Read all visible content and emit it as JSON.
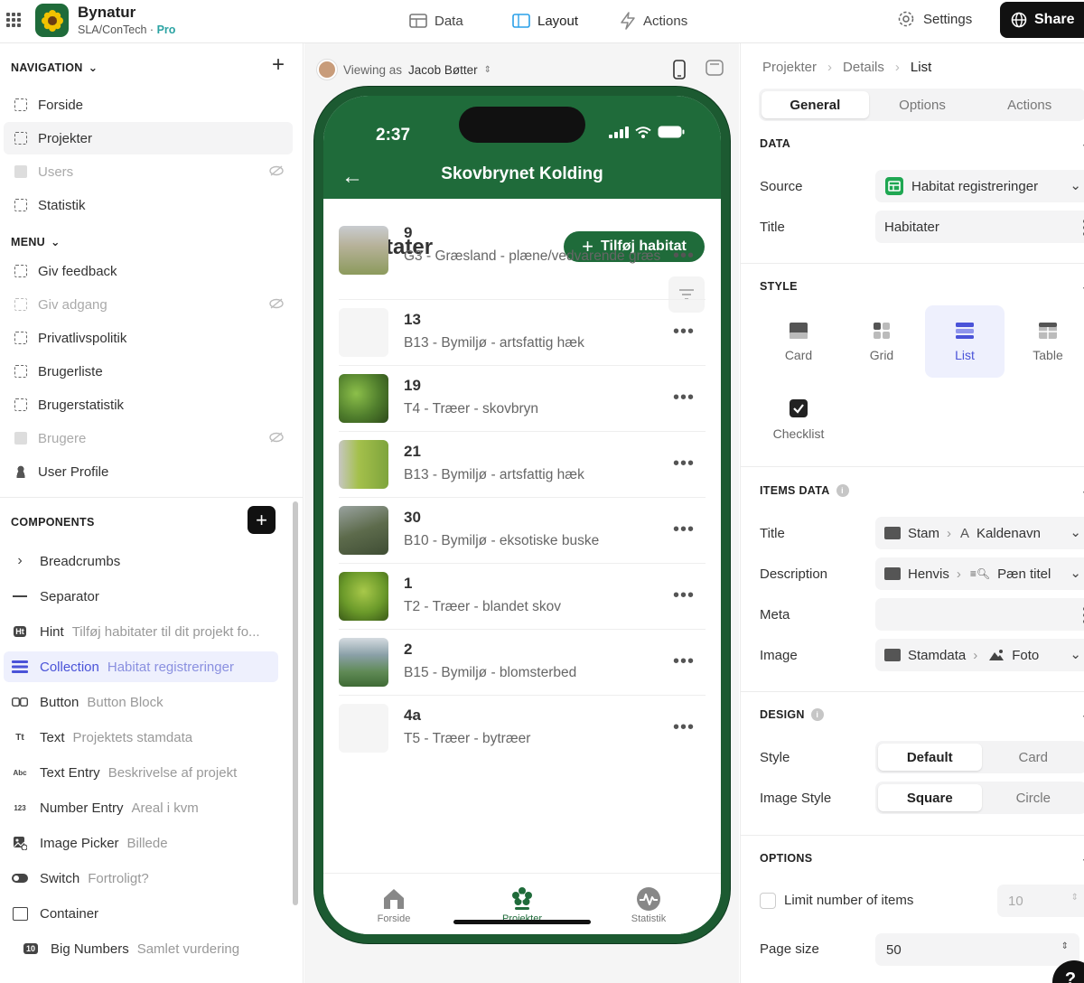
{
  "app": {
    "name": "Bynatur",
    "org": "SLA/ConTech",
    "dot": "·",
    "plan": "Pro"
  },
  "top_tabs": [
    {
      "label": "Data"
    },
    {
      "label": "Layout"
    },
    {
      "label": "Actions"
    }
  ],
  "settings_label": "Settings",
  "share_label": "Share",
  "navigation": {
    "title": "NAVIGATION",
    "items": [
      {
        "label": "Forside"
      },
      {
        "label": "Projekter"
      },
      {
        "label": "Users"
      },
      {
        "label": "Statistik"
      }
    ]
  },
  "menu": {
    "title": "MENU",
    "items": [
      {
        "label": "Giv feedback"
      },
      {
        "label": "Giv adgang"
      },
      {
        "label": "Privatlivspolitik"
      },
      {
        "label": "Brugerliste"
      },
      {
        "label": "Brugerstatistik"
      },
      {
        "label": "Brugere"
      },
      {
        "label": "User Profile"
      }
    ]
  },
  "components": {
    "title": "COMPONENTS",
    "items": [
      {
        "label": "Breadcrumbs",
        "sub": ""
      },
      {
        "label": "Separator",
        "sub": ""
      },
      {
        "label": "Hint",
        "sub": "Tilføj habitater til dit projekt fo...",
        "icon": "Ht"
      },
      {
        "label": "Collection",
        "sub": "Habitat registreringer"
      },
      {
        "label": "Button",
        "sub": "Button Block"
      },
      {
        "label": "Text",
        "sub": "Projektets stamdata",
        "icon": "Tt"
      },
      {
        "label": "Text Entry",
        "sub": "Beskrivelse af projekt",
        "icon": "Abc"
      },
      {
        "label": "Number Entry",
        "sub": "Areal i kvm",
        "icon": "123"
      },
      {
        "label": "Image Picker",
        "sub": "Billede"
      },
      {
        "label": "Switch",
        "sub": "Fortroligt?"
      },
      {
        "label": "Container",
        "sub": ""
      },
      {
        "label": "Big Numbers",
        "sub": "Samlet vurdering",
        "icon": "10"
      }
    ]
  },
  "viewing": {
    "prefix": "Viewing as",
    "user": "Jacob Bøtter"
  },
  "phone": {
    "time": "2:37",
    "title": "Skovbrynet Kolding",
    "list_title": "Habitater",
    "add_button": "Tilføj habitat",
    "rows": [
      {
        "num": "9",
        "desc": "G3 - Græsland - plæne/vedvarende græs",
        "thumb": "#9aa070"
      },
      {
        "num": "13",
        "desc": "B13 - Bymiljø - artsfattig hæk",
        "thumb": ""
      },
      {
        "num": "19",
        "desc": "T4 - Træer - skovbryn",
        "thumb": "#4f7d2c"
      },
      {
        "num": "21",
        "desc": "B13 - Bymiljø - artsfattig hæk",
        "thumb": "#7ea43c"
      },
      {
        "num": "30",
        "desc": "B10 - Bymiljø - eksotiske buske",
        "thumb": "#5d6b4c"
      },
      {
        "num": "1",
        "desc": "T2 - Træer - blandet skov",
        "thumb": "#6b9a2a"
      },
      {
        "num": "2",
        "desc": "B15 - Bymiljø - blomsterbed",
        "thumb": "#5f8a55"
      },
      {
        "num": "4a",
        "desc": "T5 - Træer - bytræer",
        "thumb": ""
      }
    ],
    "bottom_nav": [
      {
        "label": "Forside"
      },
      {
        "label": "Projekter"
      },
      {
        "label": "Statistik"
      }
    ]
  },
  "panel": {
    "breadcrumb": [
      "Projekter",
      "Details",
      "List"
    ],
    "tabs": [
      "General",
      "Options",
      "Actions"
    ],
    "data": {
      "title": "DATA",
      "source_label": "Source",
      "source_value": "Habitat registreringer",
      "title_label": "Title",
      "title_value": "Habitater"
    },
    "style": {
      "title": "STYLE",
      "options": [
        "Card",
        "Grid",
        "List",
        "Table",
        "Checklist"
      ]
    },
    "items_data": {
      "title": "ITEMS DATA",
      "title_label": "Title",
      "title_a": "Stam",
      "title_b": "Kaldenavn",
      "title_b_icon": "A",
      "desc_label": "Description",
      "desc_a": "Henvis",
      "desc_b": "Pæn titel",
      "meta_label": "Meta",
      "image_label": "Image",
      "image_a": "Stamdata",
      "image_b": "Foto"
    },
    "design": {
      "title": "DESIGN",
      "style_label": "Style",
      "style_options": [
        "Default",
        "Card"
      ],
      "image_style_label": "Image Style",
      "image_style_options": [
        "Square",
        "Circle"
      ]
    },
    "options": {
      "title": "OPTIONS",
      "limit_label": "Limit number of items",
      "limit_value": "10",
      "page_size_label": "Page size",
      "page_size_value": "50"
    },
    "help_label": "?"
  },
  "colors": {
    "brand_green": "#1f6b3a",
    "accent_blue": "#4a53d8",
    "pro_teal": "#2ba3a3"
  }
}
